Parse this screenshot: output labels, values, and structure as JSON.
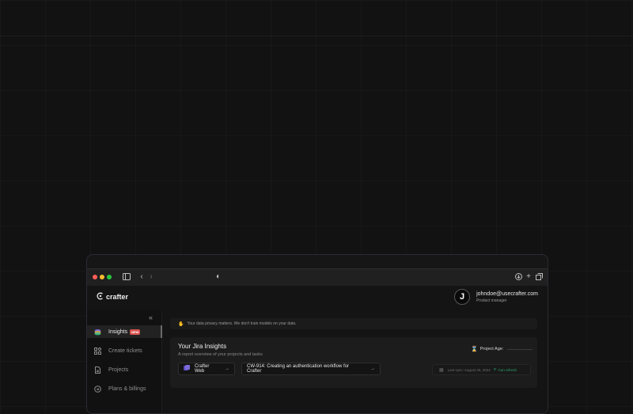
{
  "browser": {
    "toolbar": {
      "sidebar_icon": "sidebar-icon",
      "back_icon": "chevron-left-icon",
      "forward_icon": "chevron-right-icon",
      "shield_icon": "shield-icon",
      "download_icon": "download-icon",
      "new_tab_icon": "plus-icon",
      "tabs_icon": "tabs-icon"
    }
  },
  "app": {
    "logo_text": "crafter",
    "user": {
      "avatar_letter": "J",
      "email": "johndoe@usecrafter.com",
      "role": "Product manager"
    },
    "sidebar": {
      "collapse_icon": "«",
      "items": [
        {
          "label": "Insights",
          "badge": "NEW",
          "active": true
        },
        {
          "label": "Create tickets"
        },
        {
          "label": "Projects"
        },
        {
          "label": "Plans & billings"
        }
      ]
    },
    "privacy_notice": "Your data privacy matters. We don't train models on your data.",
    "insights_card": {
      "title": "Your Jira Insights",
      "subtitle": "A report overview of your projects and tasks",
      "project_age_label": "Project Age:",
      "project_selector": "Crafter Web",
      "ticket_selector": "CW-914: Creating an authentication workflow for Crafter",
      "last_sync": "Last sync: August 26, 2024",
      "sync_status": "Can refresh"
    }
  },
  "colors": {
    "background": "#121212",
    "accent_purple": "#7c6bd8",
    "badge_red": "#d9534f",
    "success_green": "#2fa36b"
  }
}
